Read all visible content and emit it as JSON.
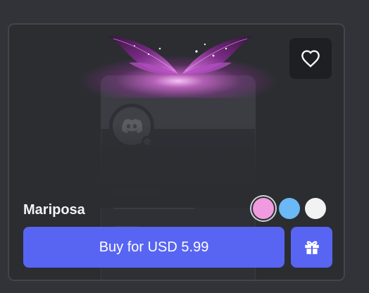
{
  "item": {
    "name": "Mariposa",
    "buy_label": "Buy for USD 5.99"
  },
  "icons": {
    "favorite": "heart-icon",
    "gift": "gift-icon",
    "avatar": "discord-logo-icon"
  },
  "swatches": [
    {
      "name": "pink",
      "color": "#f09ae0",
      "selected": true
    },
    {
      "name": "blue",
      "color": "#6ab8f5",
      "selected": false
    },
    {
      "name": "white",
      "color": "#f2f2f2",
      "selected": false
    }
  ],
  "colors": {
    "accent": "#5865f2",
    "card_background": "#2b2d31",
    "page_background": "#313338"
  }
}
